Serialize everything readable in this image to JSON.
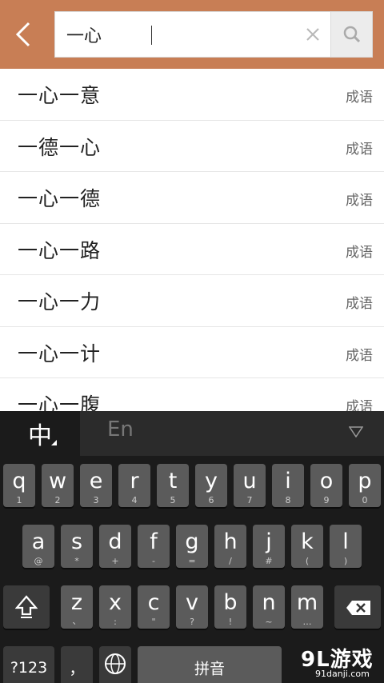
{
  "header": {
    "search_value": "一心",
    "colors": {
      "accent": "#c87e55"
    }
  },
  "results": [
    {
      "word": "一心一意",
      "tag": "成语"
    },
    {
      "word": "一德一心",
      "tag": "成语"
    },
    {
      "word": "一心一德",
      "tag": "成语"
    },
    {
      "word": "一心一路",
      "tag": "成语"
    },
    {
      "word": "一心一力",
      "tag": "成语"
    },
    {
      "word": "一心一计",
      "tag": "成语"
    },
    {
      "word": "一心一腹",
      "tag": "成语"
    }
  ],
  "keyboard": {
    "lang_cn": "中",
    "lang_en": "En",
    "row1": [
      {
        "main": "q",
        "sub": "1"
      },
      {
        "main": "w",
        "sub": "2"
      },
      {
        "main": "e",
        "sub": "3"
      },
      {
        "main": "r",
        "sub": "4"
      },
      {
        "main": "t",
        "sub": "5"
      },
      {
        "main": "y",
        "sub": "6"
      },
      {
        "main": "u",
        "sub": "7"
      },
      {
        "main": "i",
        "sub": "8"
      },
      {
        "main": "o",
        "sub": "9"
      },
      {
        "main": "p",
        "sub": "0"
      }
    ],
    "row2": [
      {
        "main": "a",
        "sub": "@"
      },
      {
        "main": "s",
        "sub": "*"
      },
      {
        "main": "d",
        "sub": "+"
      },
      {
        "main": "f",
        "sub": "-"
      },
      {
        "main": "g",
        "sub": "="
      },
      {
        "main": "h",
        "sub": "/"
      },
      {
        "main": "j",
        "sub": "#"
      },
      {
        "main": "k",
        "sub": "("
      },
      {
        "main": "l",
        "sub": ")"
      }
    ],
    "row3": [
      {
        "main": "z",
        "sub": "、"
      },
      {
        "main": "x",
        "sub": ":"
      },
      {
        "main": "c",
        "sub": "\""
      },
      {
        "main": "v",
        "sub": "?"
      },
      {
        "main": "b",
        "sub": "!"
      },
      {
        "main": "n",
        "sub": "~"
      },
      {
        "main": "m",
        "sub": "…"
      }
    ],
    "symbols_label": "?123",
    "comma_label": "，",
    "space_label": "拼音"
  },
  "watermark": {
    "title": "9L游戏",
    "domain": "91danji.com"
  }
}
